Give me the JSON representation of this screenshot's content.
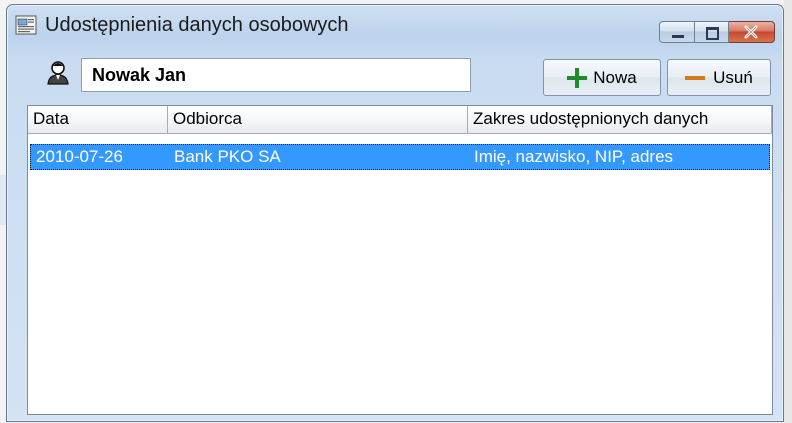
{
  "window": {
    "title": "Udostępnienia danych osobowych",
    "icon": "app-document-icon",
    "caption_buttons": [
      "minimize",
      "maximize",
      "close"
    ]
  },
  "toolbar": {
    "person_icon": "person-icon",
    "name_value": "Nowak Jan",
    "new_label": "Nowa",
    "delete_label": "Usuń",
    "new_icon": "plus-icon",
    "delete_icon": "minus-icon"
  },
  "list": {
    "columns": [
      "Data",
      "Odbiorca",
      "Zakres udostępnionych danych"
    ],
    "rows": [
      {
        "date": "2010-07-26",
        "recipient": "Bank PKO SA",
        "scope": "Imię, nazwisko, NIP, adres",
        "selected": true
      }
    ]
  },
  "colors": {
    "selection": "#3399ff",
    "plus_icon": "#1f8b2a",
    "minus_icon": "#d07a1c",
    "close_button": "#c5492e"
  }
}
